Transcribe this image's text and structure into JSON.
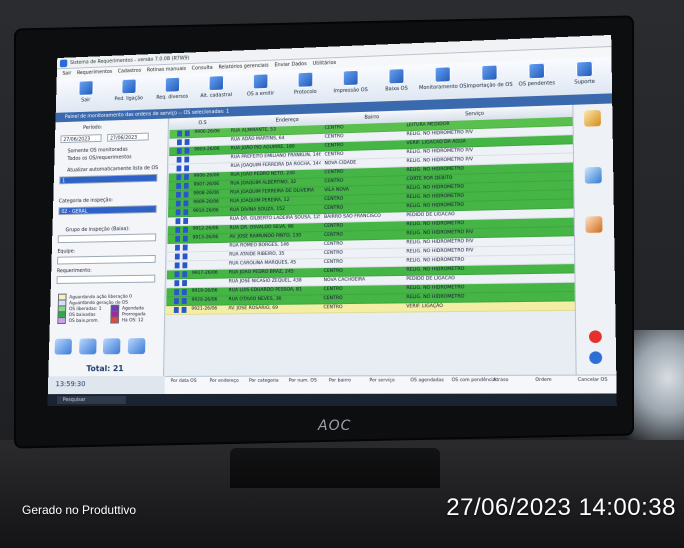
{
  "photo": {
    "app_title": "Sistema de Requerimentos - versão 7.0.0B (R7W9)",
    "menu": [
      "Sair",
      "Requerimentos",
      "Cadastros",
      "Rotinas manuais",
      "Consulta",
      "Relatórios gerenciais",
      "Enviar Dados",
      "Utilitários"
    ],
    "toolbar": [
      "Sair",
      "Ped. ligação",
      "Req. diversos",
      "Alt. cadastral",
      "OS a emitir",
      "Protocolo",
      "Impressão OS",
      "Baixa OS",
      "Monitoramento OS",
      "Importação de OS",
      "OS pendentes",
      "Suporte"
    ],
    "panel_title": "Painel de monitoramento das ordens de serviço -- OS selecionadas: 1",
    "left_panel": {
      "period_label": "Período:",
      "date_from": "27/06/2023",
      "date_to": "27/06/2023",
      "radio_1": "Somente OS monitoradas",
      "radio_2": "Todos os OS/requerimentos",
      "checkbox_auto": "Atualizar automaticamente lista de OS",
      "list_value": "1",
      "category_label": "Categoria de inspeção:",
      "category_value": "02 - GERAL",
      "group_label": "Grupo de inspeção (Baixa):",
      "team_label": "Equipe:",
      "request_label": "Requerimento:",
      "legend": [
        {
          "label": "Aguardando ação liberação 0",
          "color": "#f6f1b5"
        },
        {
          "label": "Aguardando geração de OS",
          "color": "#cfe2f7"
        },
        {
          "label": "OS liberadas: 1",
          "color": "#8fd08f"
        },
        {
          "label": "OS baixadas",
          "color": "#2eaa46"
        },
        {
          "label": "OS baix.prom.",
          "color": "#caa0e8"
        },
        {
          "label": "Agendada",
          "color": "#6a3fb5"
        },
        {
          "label": "Prorrogada",
          "color": "#9f2b9a"
        },
        {
          "label": "Há OS: 12",
          "color": "#e04a3a"
        }
      ],
      "total_label": "Total: 21",
      "clock": "13:59:30"
    },
    "grid": {
      "columns": [
        "O.S",
        "Endereço",
        "Bairro",
        "Serviço"
      ],
      "rows": [
        {
          "os": "9900-26/06",
          "end": "RUA ALMIRANTE, 53",
          "bairro": "CENTRO",
          "servico": "LEITURA MEDIDOR",
          "color": "#59c04e"
        },
        {
          "os": "",
          "end": "RUA ADÃO MARTINS, 64",
          "bairro": "CENTRO",
          "servico": "RELIG. NO HIDROMETRO P/V",
          "color": "#eef2f7"
        },
        {
          "os": "9903-26/06",
          "end": "RUA JOÃO PIO AGUIRRE, 180",
          "bairro": "CENTRO",
          "servico": "VERIF. LIGACAO DA AGUA",
          "color": "#45b545"
        },
        {
          "os": "",
          "end": "RUA PREFEITO EMILIANO FRANKLIN, 146",
          "bairro": "CENTRO",
          "servico": "RELIG. NO HIDROMETRO P/V",
          "color": "#eef2f7"
        },
        {
          "os": "",
          "end": "RUA JOAQUIM FERREIRA DA ROCHA, 144",
          "bairro": "NOVA CIDADE",
          "servico": "RELIG. NO HIDROMETRO P/V",
          "color": "#eef2f7"
        },
        {
          "os": "9906-26/06",
          "end": "RUA JOÃO PEDRO NETO, 230",
          "bairro": "CENTRO",
          "servico": "RELIG. NO HIDROMETRO",
          "color": "#45b545"
        },
        {
          "os": "9907-26/06",
          "end": "RUA JOAQUIM ALBERTINO, 32",
          "bairro": "CENTRO",
          "servico": "CORTE POR DEBITO",
          "color": "#45b545"
        },
        {
          "os": "9908-26/06",
          "end": "RUA JOAQUIM FERREIRA DE OLIVEIRA",
          "bairro": "VILA NOVA",
          "servico": "RELIG. NO HIDROMETRO",
          "color": "#45b545"
        },
        {
          "os": "9909-26/06",
          "end": "RUA JOAQUIM PEREIRA, 12",
          "bairro": "CENTRO",
          "servico": "RELIG. NO HIDROMETRO",
          "color": "#45b545"
        },
        {
          "os": "9910-26/06",
          "end": "RUA DIVINA SOUZA, 152",
          "bairro": "CENTRO",
          "servico": "RELIG. NO HIDROMETRO",
          "color": "#45b545"
        },
        {
          "os": "",
          "end": "RUA DR. GILBERTO LADEIRA SOUSA, 125",
          "bairro": "BAIRRO SAO FRANCISCO",
          "servico": "PEDIDO DE LIGACAO",
          "color": "#eef2f7"
        },
        {
          "os": "9912-26/06",
          "end": "RUA DR. OSVALDO SILVA, 86",
          "bairro": "CENTRO",
          "servico": "RELIG. NO HIDROMETRO",
          "color": "#45b545"
        },
        {
          "os": "9913-26/06",
          "end": "AV. JOSÉ RAIMUNDO PINTO, 130",
          "bairro": "CENTRO",
          "servico": "RELIG. NO HIDROMETRO P/V",
          "color": "#45b545"
        },
        {
          "os": "",
          "end": "RUA ROMEO BORGES, 146",
          "bairro": "CENTRO",
          "servico": "RELIG. NO HIDROMETRO P/V",
          "color": "#eef2f7"
        },
        {
          "os": "",
          "end": "RUA ATAIDE RIBEIRO, 35",
          "bairro": "CENTRO",
          "servico": "RELIG. NO HIDROMETRO P/V",
          "color": "#eef2f7"
        },
        {
          "os": "",
          "end": "RUA CAROLINA MARQUES, 45",
          "bairro": "CENTRO",
          "servico": "RELIG. NO HIDROMETRO",
          "color": "#eef2f7"
        },
        {
          "os": "9917-26/06",
          "end": "RUA JOAO PEDRO BRAZ, 245",
          "bairro": "CENTRO",
          "servico": "RELIG. NO HIDROMETRO",
          "color": "#45b545"
        },
        {
          "os": "",
          "end": "RUA JOSÉ NICASIO ZEQUEL, 438",
          "bairro": "NOVA CACHOEIRA",
          "servico": "PEDIDO DE LIGACAO",
          "color": "#eef2f7"
        },
        {
          "os": "9919-26/06",
          "end": "RUA LUIS EDUARDO PESSOA, 81",
          "bairro": "CENTRO",
          "servico": "RELIG. NO HIDROMETRO",
          "color": "#45b545"
        },
        {
          "os": "9920-26/06",
          "end": "RUA OTAVIO NEVES, 36",
          "bairro": "CENTRO",
          "servico": "RELIG. NO HIDROMETRO",
          "color": "#45b545"
        },
        {
          "os": "9921-26/06",
          "end": "AV. JOSÉ ROSÁRIO, 69",
          "bairro": "CENTRO",
          "servico": "VERIF. LIGAÇÃO",
          "color": "#f3eea4"
        }
      ]
    },
    "filters": [
      "Por data OS",
      "Por endereço",
      "Por categoria",
      "Por num. OS",
      "Por bairro",
      "Por serviço",
      "OS agendadas",
      "OS com pendência",
      "Atraso",
      "Ordem",
      "Cancelar OS"
    ],
    "taskbar_search": "Pesquisar",
    "brand": "AOC"
  },
  "watermark": {
    "left": "Gerado no Produttivo",
    "right": "27/06/2023 14:00:38"
  }
}
